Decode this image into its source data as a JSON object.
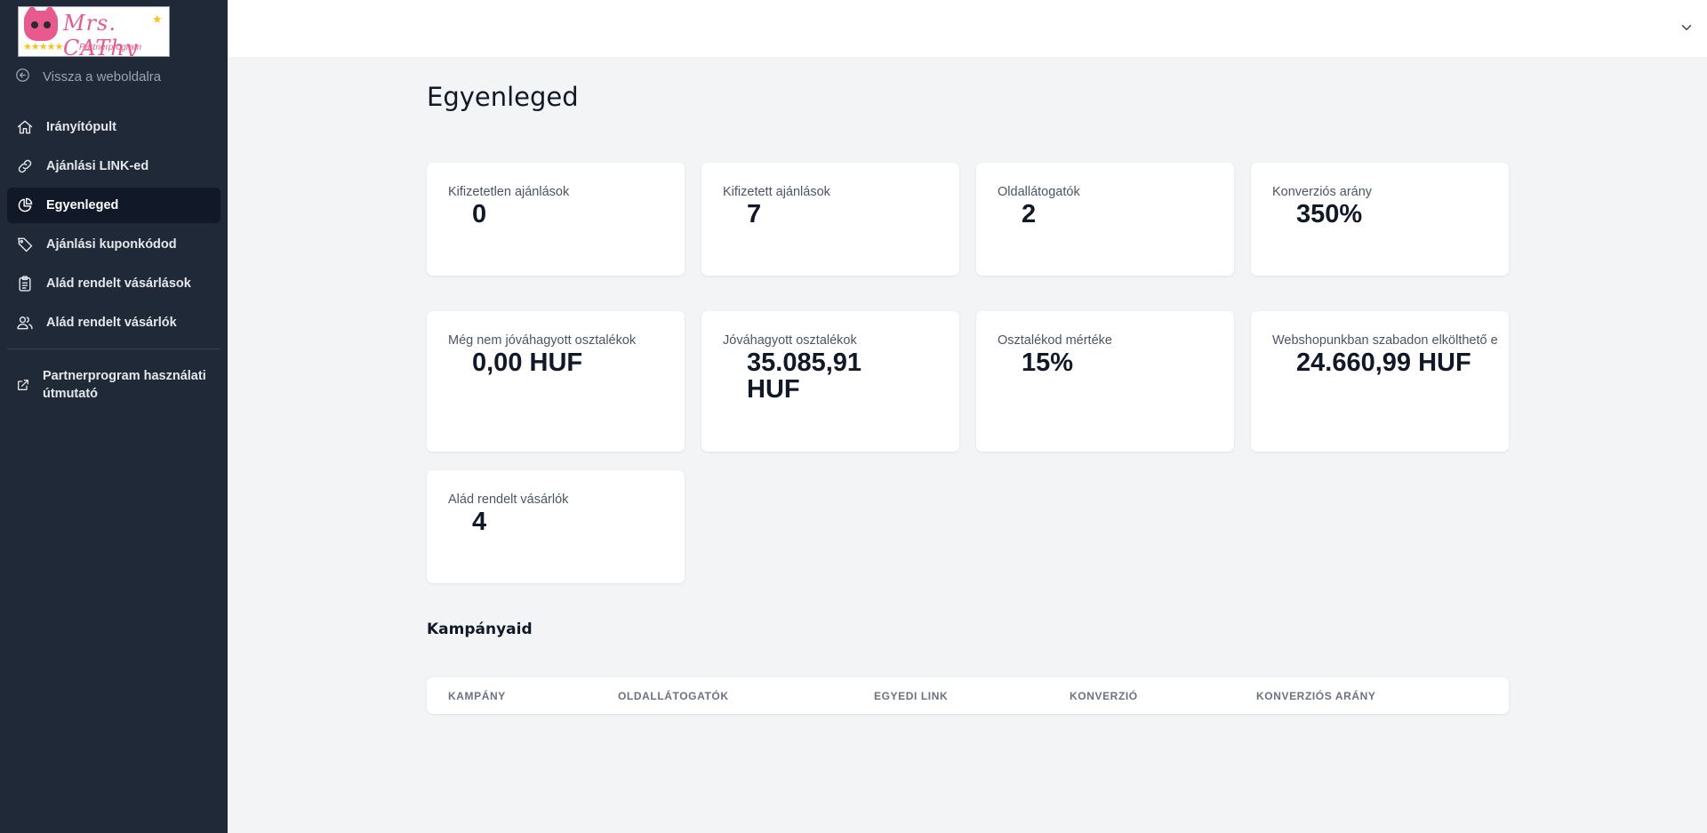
{
  "logo": {
    "name": "Mrs. CAThy",
    "subtitle": "Partnerprogram",
    "stars": "★★★★★",
    "spark": "★"
  },
  "sidebar": {
    "back_label": "Vissza a weboldalra",
    "items": [
      {
        "label": "Irányítópult",
        "icon": "home-icon"
      },
      {
        "label": "Ajánlási LINK-ed",
        "icon": "link-icon"
      },
      {
        "label": "Egyenleged",
        "icon": "chart-pie-icon",
        "active": true
      },
      {
        "label": "Ajánlási kuponkódod",
        "icon": "tag-icon"
      },
      {
        "label": "Alád rendelt vásárlások",
        "icon": "clipboard-icon"
      },
      {
        "label": "Alád rendelt vásárlók",
        "icon": "users-icon"
      }
    ],
    "external_label": "Partnerprogram használati útmutató"
  },
  "main": {
    "title": "Egyenleged",
    "cards": [
      {
        "label": "Kifizetetlen ajánlások",
        "value": "0"
      },
      {
        "label": "Kifizetett ajánlások",
        "value": "7"
      },
      {
        "label": "Oldallátogatók",
        "value": "2"
      },
      {
        "label": "Konverziós arány",
        "value": "350%"
      },
      {
        "label": "Még nem jóváhagyott osztalékok",
        "value": "0,00 HUF"
      },
      {
        "label": "Jóváhagyott osztalékok",
        "value": "35.085,91 HUF"
      },
      {
        "label": "Osztalékod mértéke",
        "value": "15%"
      },
      {
        "label": "Webshopunkban szabadon elkölthető e",
        "value": "24.660,99 HUF"
      },
      {
        "label": "Alád rendelt vásárlók",
        "value": "4"
      }
    ],
    "campaigns_title": "Kampányaid",
    "table_headers": [
      "Kampány",
      "Oldallátogatók",
      "Egyedi link",
      "Konverzió",
      "Konverziós arány"
    ]
  }
}
